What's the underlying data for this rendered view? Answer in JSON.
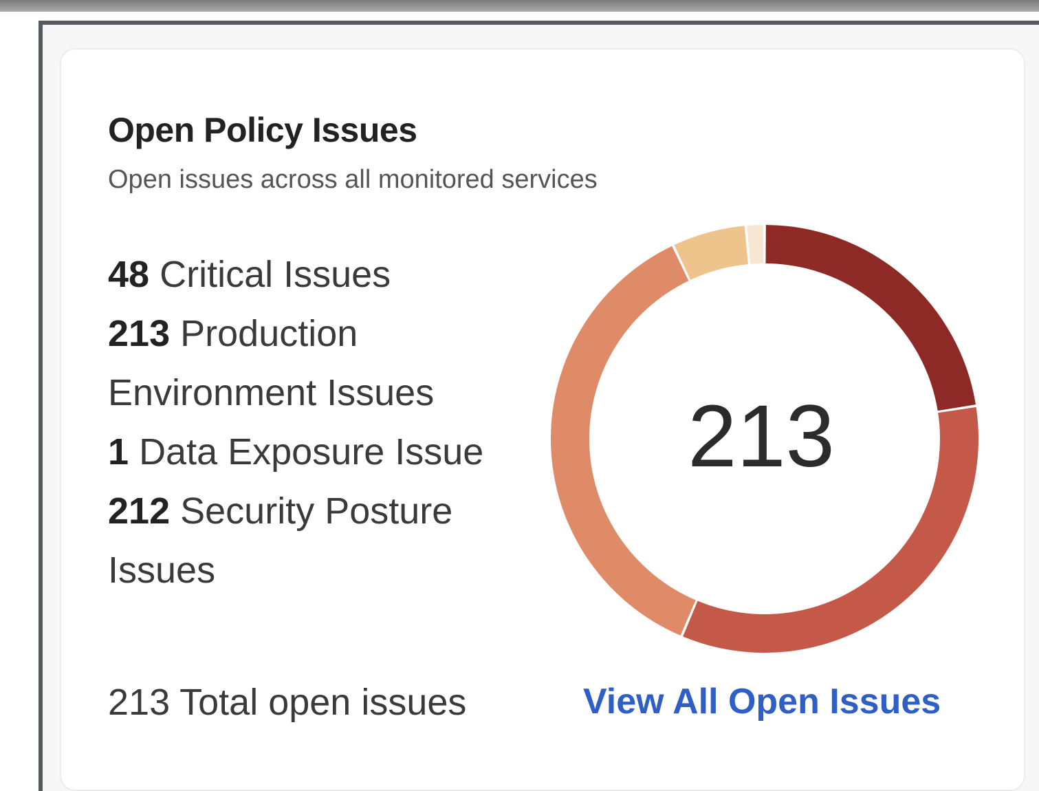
{
  "widget": {
    "title": "Open Policy Issues",
    "subtitle": "Open issues across all monitored services"
  },
  "stats": [
    {
      "count": "48",
      "label": "Critical Issues"
    },
    {
      "count": "213",
      "label": "Production Environment Issues"
    },
    {
      "count": "1",
      "label": "Data Exposure Issue"
    },
    {
      "count": "212",
      "label": "Security Posture Issues"
    }
  ],
  "donut": {
    "center_value": "213",
    "segments": [
      {
        "value": 48,
        "color": "#8e2a25"
      },
      {
        "value": 72,
        "color": "#c4594a"
      },
      {
        "value": 78,
        "color": "#e08b68"
      },
      {
        "value": 12,
        "color": "#efc48c"
      },
      {
        "value": 3,
        "color": "#f7e6d2"
      }
    ]
  },
  "footer": {
    "total_text": "213 Total open issues",
    "view_all_label": "View All Open Issues"
  }
}
